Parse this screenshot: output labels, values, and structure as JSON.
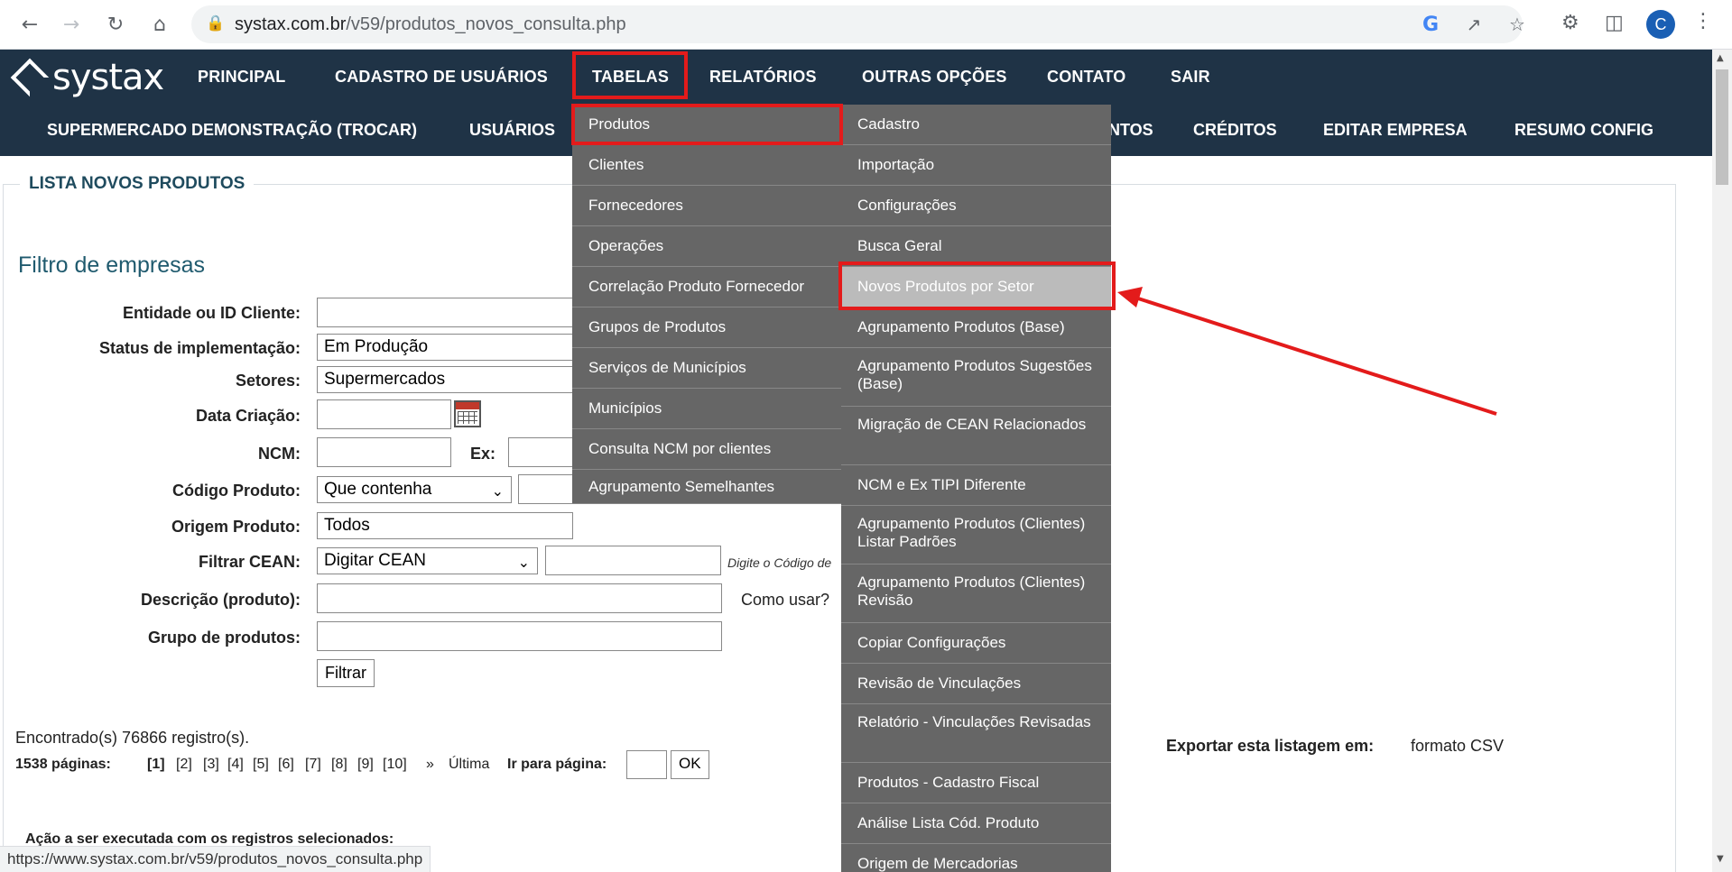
{
  "browser": {
    "url_host": "systax.com.br",
    "url_path": "/v59/produtos_novos_consulta.php",
    "avatar_letter": "C",
    "status_url": "https://www.systax.com.br/v59/produtos_novos_consulta.php"
  },
  "site": {
    "logo_text": "systax",
    "topnav": [
      "PRINCIPAL",
      "CADASTRO DE USUÁRIOS",
      "TABELAS",
      "RELATÓRIOS",
      "OUTRAS OPÇÕES",
      "CONTATO",
      "SAIR"
    ],
    "subnav": [
      "SUPERMERCADO DEMONSTRAÇÃO  (TROCAR)",
      "USUÁRIOS",
      "NTOS",
      "CRÉDITOS",
      "EDITAR EMPRESA",
      "RESUMO CONFIG"
    ]
  },
  "menu_tabelas": [
    "Produtos",
    "Clientes",
    "Fornecedores",
    "Operações",
    "Correlação Produto Fornecedor",
    "Grupos de Produtos",
    "Serviços de Municípios",
    "Municípios",
    "Consulta NCM por clientes",
    "Agrupamento Semelhantes"
  ],
  "menu_produtos": [
    "Cadastro",
    "Importação",
    "Configurações",
    "Busca Geral",
    "Novos Produtos por Setor",
    "Agrupamento Produtos (Base)",
    "Agrupamento Produtos Sugestões (Base)",
    "Migração de CEAN Relacionados",
    "NCM e Ex TIPI Diferente",
    "Agrupamento Produtos (Clientes) Listar Padrões",
    "Agrupamento Produtos (Clientes) Revisão",
    "Copiar Configurações",
    "Revisão de Vinculações",
    "Relatório - Vinculações Revisadas",
    "Produtos - Cadastro Fiscal",
    "Análise Lista Cód. Produto",
    "Origem de Mercadorias"
  ],
  "page": {
    "legend": "LISTA NOVOS PRODUTOS",
    "filter_title": "Filtro de empresas",
    "labels": {
      "entidade": "Entidade ou ID Cliente:",
      "status": "Status de implementação:",
      "setores": "Setores:",
      "data_criacao": "Data Criação:",
      "ncm": "NCM:",
      "ex": "Ex:",
      "codigo": "Código Produto:",
      "origem": "Origem Produto:",
      "cean": "Filtrar CEAN:",
      "descricao": "Descrição (produto):",
      "grupo": "Grupo de produtos:"
    },
    "values": {
      "status": "Em Produção",
      "setores": "Supermercados",
      "codigo_mode": "Que contenha",
      "origem": "Todos",
      "cean_mode": "Digitar CEAN"
    },
    "cean_hint": "Digite o Código de",
    "como_usar": "Como usar?",
    "filter_button": "Filtrar",
    "found": "Encontrado(s) 76866 registro(s).",
    "pages_count": "1538 páginas:",
    "current_page": "[1]",
    "page_links": [
      "[2]",
      "[3]",
      "[4]",
      "[5]",
      "[6]",
      "[7]",
      "[8]",
      "[9]",
      "[10]"
    ],
    "next": "»",
    "last": "Última",
    "goto_label": "Ir para página:",
    "ok": "OK",
    "export_label": "Exportar esta listagem em:",
    "export_link": "formato CSV",
    "action_label": "Ação a ser executada com os registros selecionados:"
  },
  "colors": {
    "header_bg": "#1f3346",
    "menu_bg": "#666666",
    "highlight": "#e31b1b"
  }
}
